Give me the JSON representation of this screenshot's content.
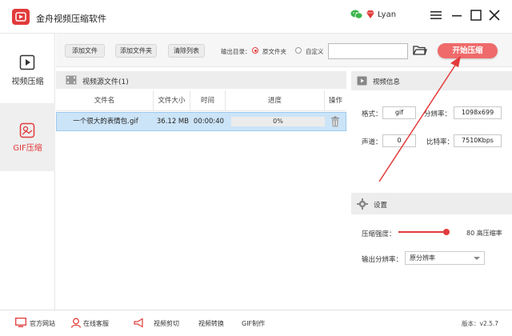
{
  "app": {
    "title": "金舟视频压缩软件",
    "username": "Lyan"
  },
  "sidebar": {
    "items": [
      {
        "label": "视频压缩"
      },
      {
        "label": "GIF压缩"
      }
    ]
  },
  "toolbar": {
    "add_file": "添加文件",
    "add_folder": "添加文件夹",
    "clear_list": "清除列表",
    "output_label": "输出目录：",
    "option_source": "原文件夹",
    "option_custom": "自定义",
    "output_path": "",
    "start_button": "开始压缩"
  },
  "file_list": {
    "title": "视频源文件(1)",
    "columns": [
      "文件名",
      "文件大小",
      "时间",
      "进度",
      "操作"
    ],
    "rows": [
      {
        "name": "一个很大的表情包.gif",
        "size": "36.12 MB",
        "time": "00:00:40",
        "progress": "0%",
        "progress_value": 0
      }
    ]
  },
  "video_info": {
    "title": "视频信息",
    "format_label": "格式：",
    "format_value": "gif",
    "resolution_label": "分辨率：",
    "resolution_value": "1098x699",
    "channel_label": "声道：",
    "channel_value": "0",
    "bitrate_label": "比特率：",
    "bitrate_value": "7510Kbps"
  },
  "settings": {
    "title": "设置",
    "compress_label": "压缩强度：",
    "compress_value": 80,
    "compress_value_text": "80",
    "compress_suffix": "高压缩率",
    "resolution_label": "输出分辨率：",
    "resolution_selected": "原分辨率"
  },
  "footer": {
    "links": [
      "官方网站",
      "在线客服",
      "视频剪切",
      "视频转换",
      "GIF制作"
    ],
    "version": "版本：v2.5.7"
  },
  "colors": {
    "accent": "#e23b3b",
    "start_button": "#ef6a6a",
    "selected_row": "#cce4f7",
    "arrow": "#e23b3b"
  },
  "icons": {
    "logo": "play-logo-icon",
    "wechat": "wechat-icon",
    "vip": "vip-diamond-icon",
    "video_compress": "video-compress-icon",
    "gif_compress": "gif-compress-icon",
    "folder": "folder-icon",
    "trash": "trash-icon",
    "gear": "gear-icon"
  }
}
